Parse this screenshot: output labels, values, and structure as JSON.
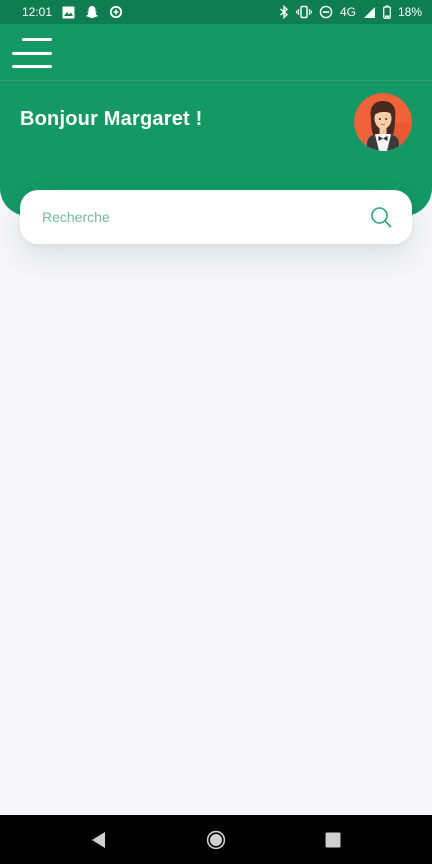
{
  "status_bar": {
    "time": "12:01",
    "network": "4G",
    "battery": "18%",
    "left_icons": [
      "image-icon",
      "snapchat-icon",
      "data-saver-icon"
    ],
    "right_icons": [
      "bluetooth-icon",
      "vibrate-icon",
      "do-not-disturb-icon",
      "signal-icon",
      "battery-icon"
    ]
  },
  "header": {
    "greeting": "Bonjour Margaret !",
    "menu_icon": "hamburger-menu-icon",
    "avatar_icon": "user-avatar-icon"
  },
  "search": {
    "placeholder": "Recherche",
    "value": "",
    "icon": "search-icon"
  },
  "nav": {
    "icons": [
      "back-icon",
      "home-icon",
      "recents-icon"
    ]
  },
  "colors": {
    "primary": "#149866",
    "status_bar": "#0f7d52",
    "background": "#f7f7fb",
    "search_placeholder": "#74b9a0",
    "avatar_bg": "#f0623a"
  }
}
